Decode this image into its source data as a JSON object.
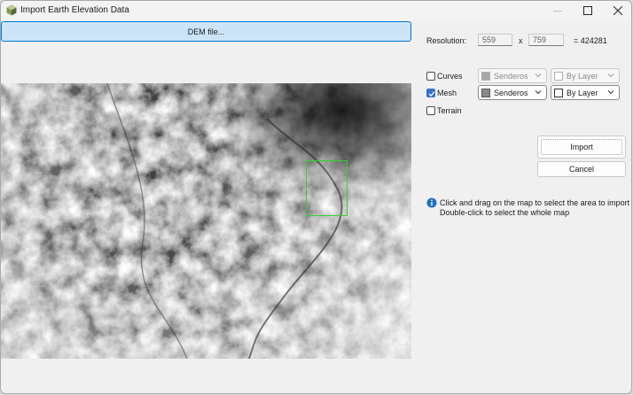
{
  "window": {
    "title": "Import Earth Elevation Data"
  },
  "dem_button": {
    "label": "DEM file..."
  },
  "resolution": {
    "label": "Resolution:",
    "width": "559",
    "separator": "x",
    "height": "759",
    "total": "= 424281"
  },
  "layers": [
    {
      "label": "Curves",
      "checked": false,
      "material": "Senderos",
      "material_color": "#9a9a9a",
      "linetype": "By Layer",
      "enabled": false
    },
    {
      "label": "Mesh",
      "checked": true,
      "material": "Senderos",
      "material_color": "#8a8a8a",
      "linetype": "By Layer",
      "enabled": true
    },
    {
      "label": "Terrain",
      "checked": false
    }
  ],
  "actions": {
    "import_label": "Import",
    "cancel_label": "Cancel"
  },
  "info": {
    "line1": "Click and drag on the map to select the area to import",
    "line2": "Double-click to select the whole map"
  },
  "colors": {
    "accent": "#0078d4",
    "selection": "#2fd12f",
    "check": "#3a71c9"
  }
}
